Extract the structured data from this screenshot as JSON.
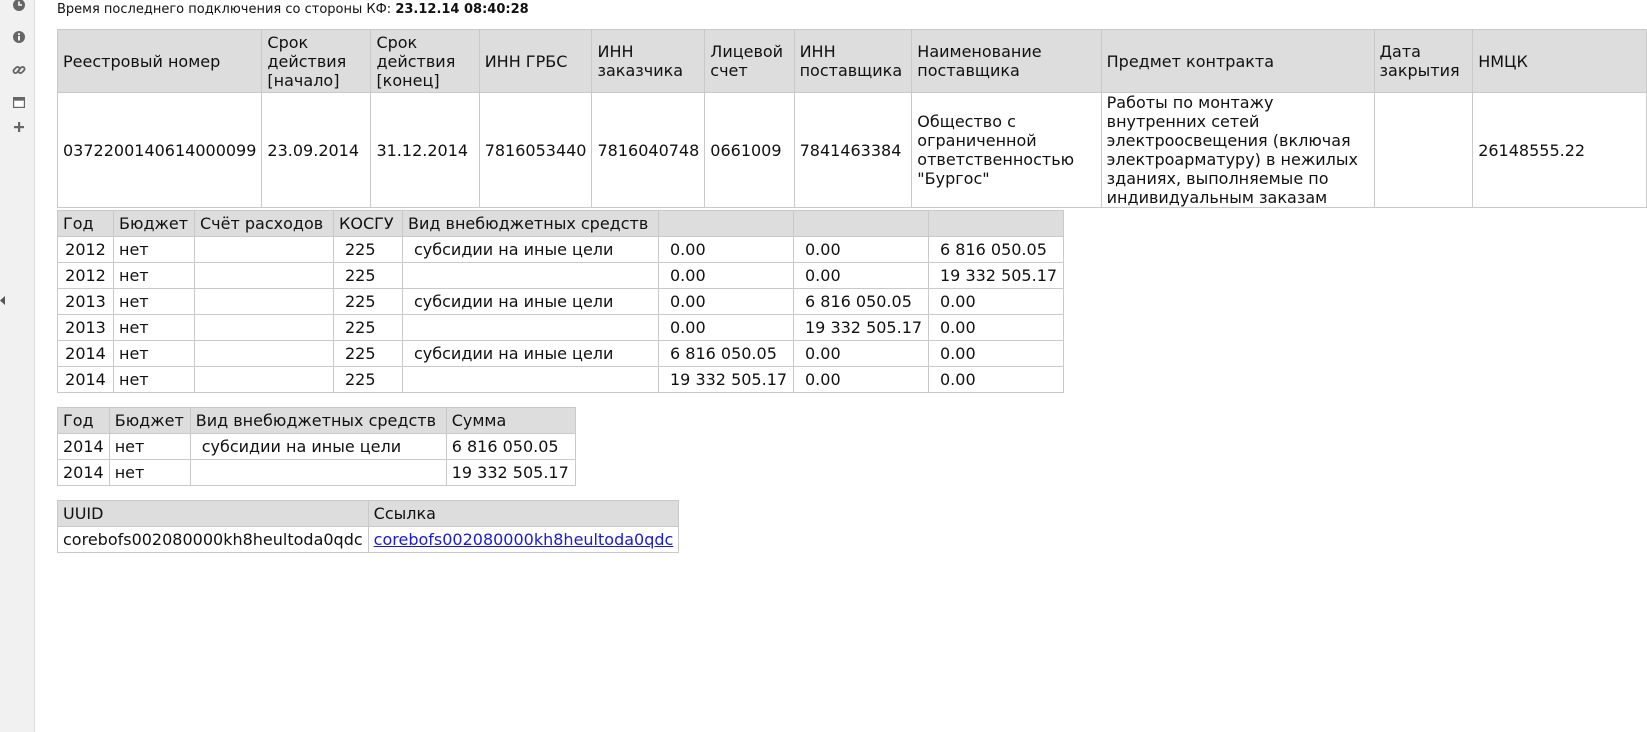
{
  "status": {
    "label": "Время последнего подключения со стороны КФ:",
    "value": "23.12.14 08:40:28"
  },
  "sidebar": {
    "icons": [
      "clock-icon",
      "info-icon",
      "link-icon",
      "calendar-icon",
      "plus-icon"
    ]
  },
  "contract": {
    "headers": [
      "Реестровый номер",
      "Срок действия [начало]",
      "Срок действия [конец]",
      "ИНН ГРБС",
      "ИНН заказчика",
      "Лицевой счет",
      "ИНН поставщика",
      "Наименование поставщика",
      "Предмет контракта",
      "Дата закрытия",
      "НМЦК"
    ],
    "row": [
      "0372200140614000099",
      "23.09.2014",
      "31.12.2014",
      "7816053440",
      "7816040748",
      "0661009",
      "7841463384",
      "Общество с ограниченной ответственностью \"Бургос\"",
      "Работы по монтажу внутренних сетей электроосвещения (включая электроарматуру) в нежилых зданиях, выполняемые по индивидуальным заказам",
      "",
      "26148555.22"
    ]
  },
  "finance": {
    "headers": [
      "Год",
      "Бюджет",
      "Счёт расходов",
      "КОСГУ",
      "Вид внебюджетных средств",
      "",
      "",
      ""
    ],
    "rows": [
      [
        "2012",
        "нет",
        "",
        "225",
        "субсидии на иные цели",
        "0.00",
        "0.00",
        "6 816 050.05"
      ],
      [
        "2012",
        "нет",
        "",
        "225",
        "",
        "0.00",
        "0.00",
        "19 332 505.17"
      ],
      [
        "2013",
        "нет",
        "",
        "225",
        "субсидии на иные цели",
        "0.00",
        "6 816 050.05",
        "0.00"
      ],
      [
        "2013",
        "нет",
        "",
        "225",
        "",
        "0.00",
        "19 332 505.17",
        "0.00"
      ],
      [
        "2014",
        "нет",
        "",
        "225",
        "субсидии на иные цели",
        "6 816 050.05",
        "0.00",
        "0.00"
      ],
      [
        "2014",
        "нет",
        "",
        "225",
        "",
        "19 332 505.17",
        "0.00",
        "0.00"
      ]
    ]
  },
  "summary": {
    "headers": [
      "Год",
      "Бюджет",
      "Вид внебюджетных средств",
      "Сумма"
    ],
    "rows": [
      [
        "2014",
        "нет",
        "субсидии на иные цели",
        "6 816 050.05"
      ],
      [
        "2014",
        "нет",
        "",
        "19 332 505.17"
      ]
    ]
  },
  "uuid": {
    "headers": [
      "UUID",
      "Ссылка"
    ],
    "value": "corebofs002080000kh8heultoda0qdc",
    "link": "corebofs002080000kh8heultoda0qdc"
  },
  "colors": {
    "header_bg": "#dddddd",
    "border": "#c9c9c9",
    "link": "#1a1ad6",
    "sidebar_bg": "#f1f1f1"
  }
}
